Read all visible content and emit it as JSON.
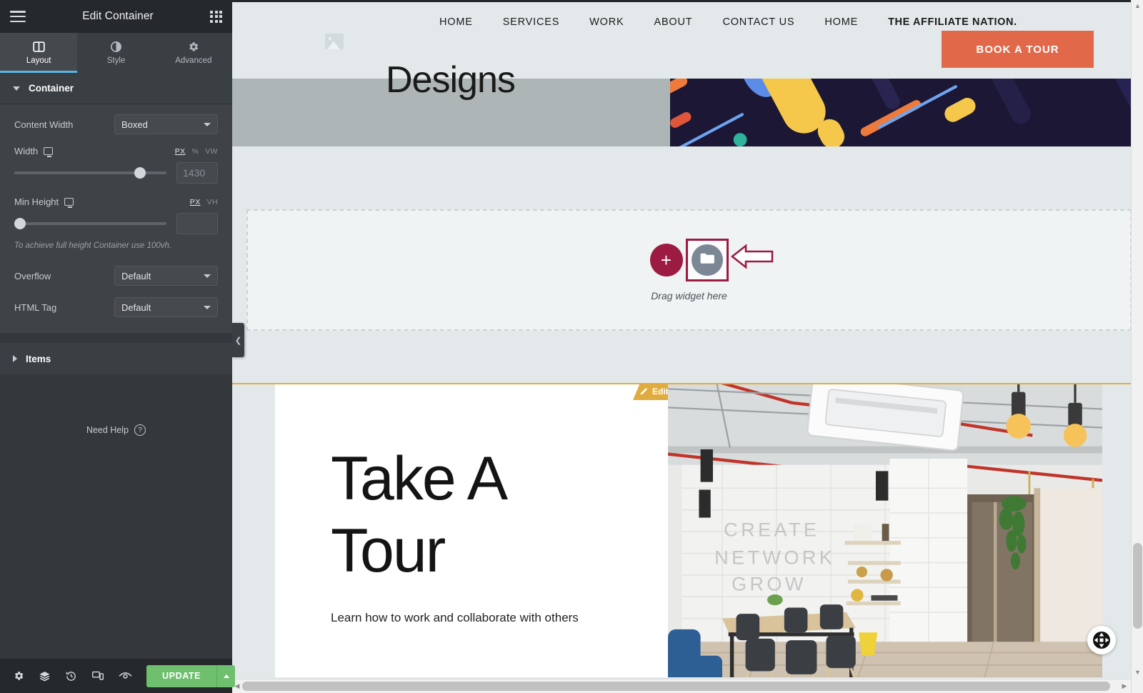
{
  "panel": {
    "title": "Edit Container",
    "menu_icon": "hamburger-icon",
    "apps_icon": "grid-icon",
    "tabs": [
      {
        "label": "Layout",
        "icon": "layout-icon",
        "active": true
      },
      {
        "label": "Style",
        "icon": "contrast-icon",
        "active": false
      },
      {
        "label": "Advanced",
        "icon": "gear-icon",
        "active": false
      }
    ],
    "sections": {
      "container": {
        "label": "Container",
        "expanded": true,
        "content_width": {
          "label": "Content Width",
          "value": "Boxed"
        },
        "width": {
          "label": "Width",
          "device_icon": "desktop-icon",
          "units": [
            "PX",
            "%",
            "VW"
          ],
          "active_unit": "PX",
          "value": "1430",
          "slider_percent": 84
        },
        "min_height": {
          "label": "Min Height",
          "device_icon": "desktop-icon",
          "units": [
            "PX",
            "VH"
          ],
          "active_unit": "PX",
          "value": "",
          "slider_percent": 0
        },
        "hint": "To achieve full height Container use 100vh.",
        "overflow": {
          "label": "Overflow",
          "value": "Default"
        },
        "html_tag": {
          "label": "HTML Tag",
          "value": "Default"
        }
      },
      "items": {
        "label": "Items",
        "expanded": false
      }
    },
    "need_help": {
      "label": "Need Help",
      "icon": "question-circle-icon"
    },
    "footer": {
      "icons": [
        "settings-gear-icon",
        "layers-navigator-icon",
        "history-revisions-icon",
        "responsive-mode-icon",
        "preview-eye-icon"
      ],
      "update_label": "UPDATE",
      "update_caret_icon": "chevron-up-icon",
      "update_color": "#6ec06e"
    },
    "collapse_handle_icon": "chevron-left-icon"
  },
  "preview": {
    "nav": {
      "logo_icon": "image-placeholder-icon",
      "links": [
        "HOME",
        "SERVICES",
        "WORK",
        "ABOUT",
        "CONTACT US",
        "HOME",
        "THE AFFILIATE NATION."
      ],
      "cta": {
        "label": "BOOK A TOUR",
        "color": "#e1694a"
      }
    },
    "hero": {
      "heading": "Designs"
    },
    "drop_zone": {
      "add_icon": "plus-icon",
      "folder_icon": "folder-icon",
      "annotation_icon": "arrow-left-icon",
      "label": "Drag widget here",
      "highlight_color": "#9b1b42"
    },
    "footer": {
      "edit_tab": {
        "label": "Edit Footer",
        "icon": "pencil-icon",
        "color": "#e0ac40"
      },
      "title": "Take A\nTour",
      "subtitle": "Learn how to work and collaborate with others",
      "image_alt": "office-interior-photo"
    },
    "navigator_bubble_icon": "move-handle-icon",
    "scrollbars": {
      "vertical_up_icon": "chevron-up-icon",
      "vertical_down_icon": "chevron-down-icon",
      "horizontal_left_icon": "chevron-left-icon",
      "horizontal_right_icon": "chevron-right-icon"
    }
  }
}
